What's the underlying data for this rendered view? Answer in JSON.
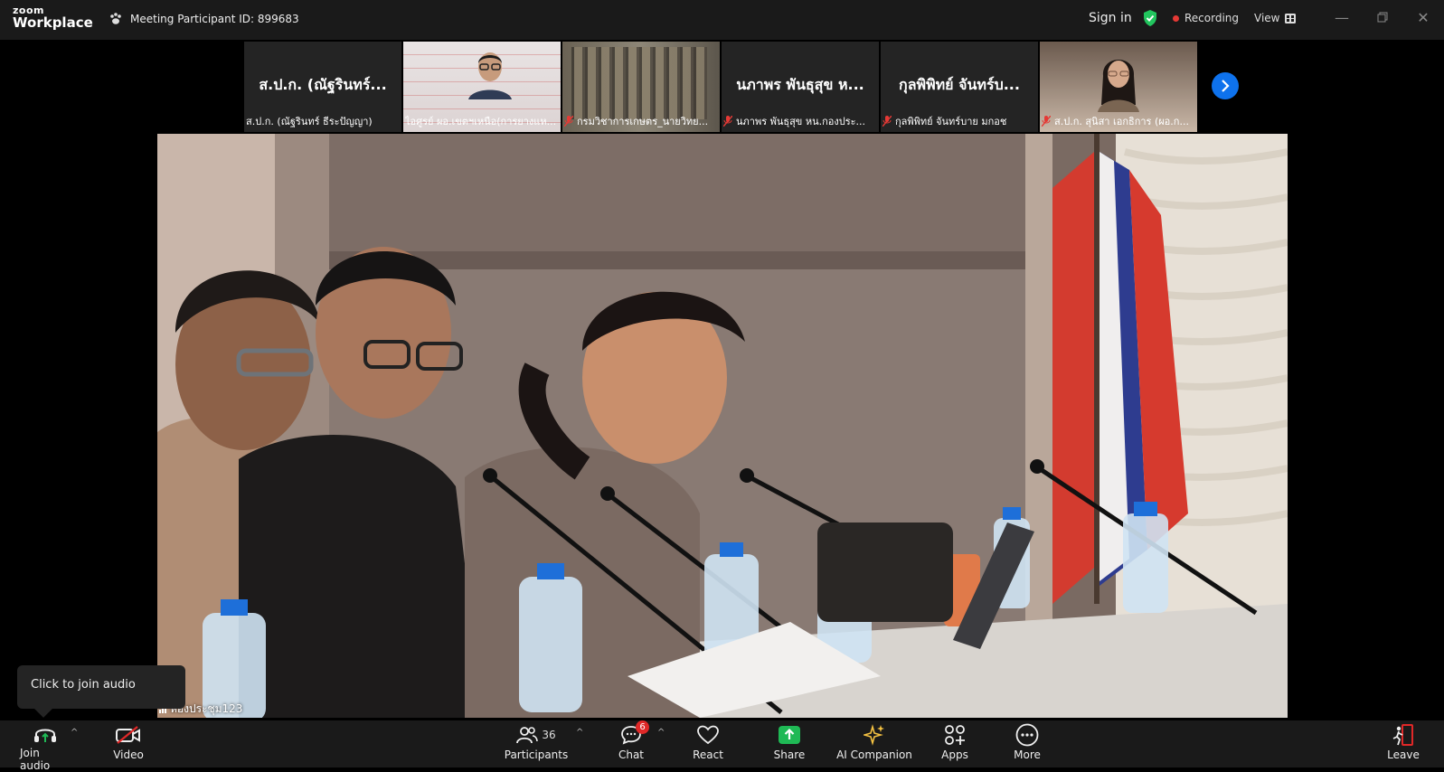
{
  "app": {
    "logo_top": "zoom",
    "logo_bottom": "Workplace"
  },
  "titlebar": {
    "meeting_id": "Meeting Participant ID: 899683",
    "sign_in": "Sign in",
    "recording": "Recording",
    "view": "View"
  },
  "thumbnails": [
    {
      "big_name": "ส.ป.ก. (ณัฐรินทร์...",
      "caption": "ส.ป.ก. (ณัฐรินทร์ ธีระปัญญา)",
      "muted": false
    },
    {
      "big_name": "",
      "caption": "ไอศูรย์ ผอ.เขตฯเหนือ(การยางแห...",
      "muted": false
    },
    {
      "big_name": "",
      "caption": "กรมวิชาการเกษตร_นายวิทย...",
      "muted": true
    },
    {
      "big_name": "นภาพร พันธุสุข ห...",
      "caption": "นภาพร พันธุสุข หน.กองประ...",
      "muted": true
    },
    {
      "big_name": "กุลพิพิทย์ จันทร์บ...",
      "caption": "กุลพิพิทย์ จันทร์บาย มกอช",
      "muted": true
    },
    {
      "big_name": "",
      "caption": "ส.ป.ก. สุนิสา เอกธิการ (ผอ.ก...",
      "muted": true
    }
  ],
  "main_video": {
    "label": "ห้องประชุม123"
  },
  "tooltip": {
    "text": "Click to join audio"
  },
  "toolbar": {
    "join_audio": "Join audio",
    "video": "Video",
    "participants": "Participants",
    "participants_count": "36",
    "chat": "Chat",
    "chat_badge": "6",
    "react": "React",
    "share": "Share",
    "ai_companion": "AI Companion",
    "apps": "Apps",
    "more": "More",
    "leave": "Leave"
  },
  "colors": {
    "accent_blue": "#0e72ed",
    "share_green": "#1fb955",
    "leave_red": "#e02828",
    "ai_yellow": "#f5c242",
    "shield_green": "#22c55e"
  }
}
